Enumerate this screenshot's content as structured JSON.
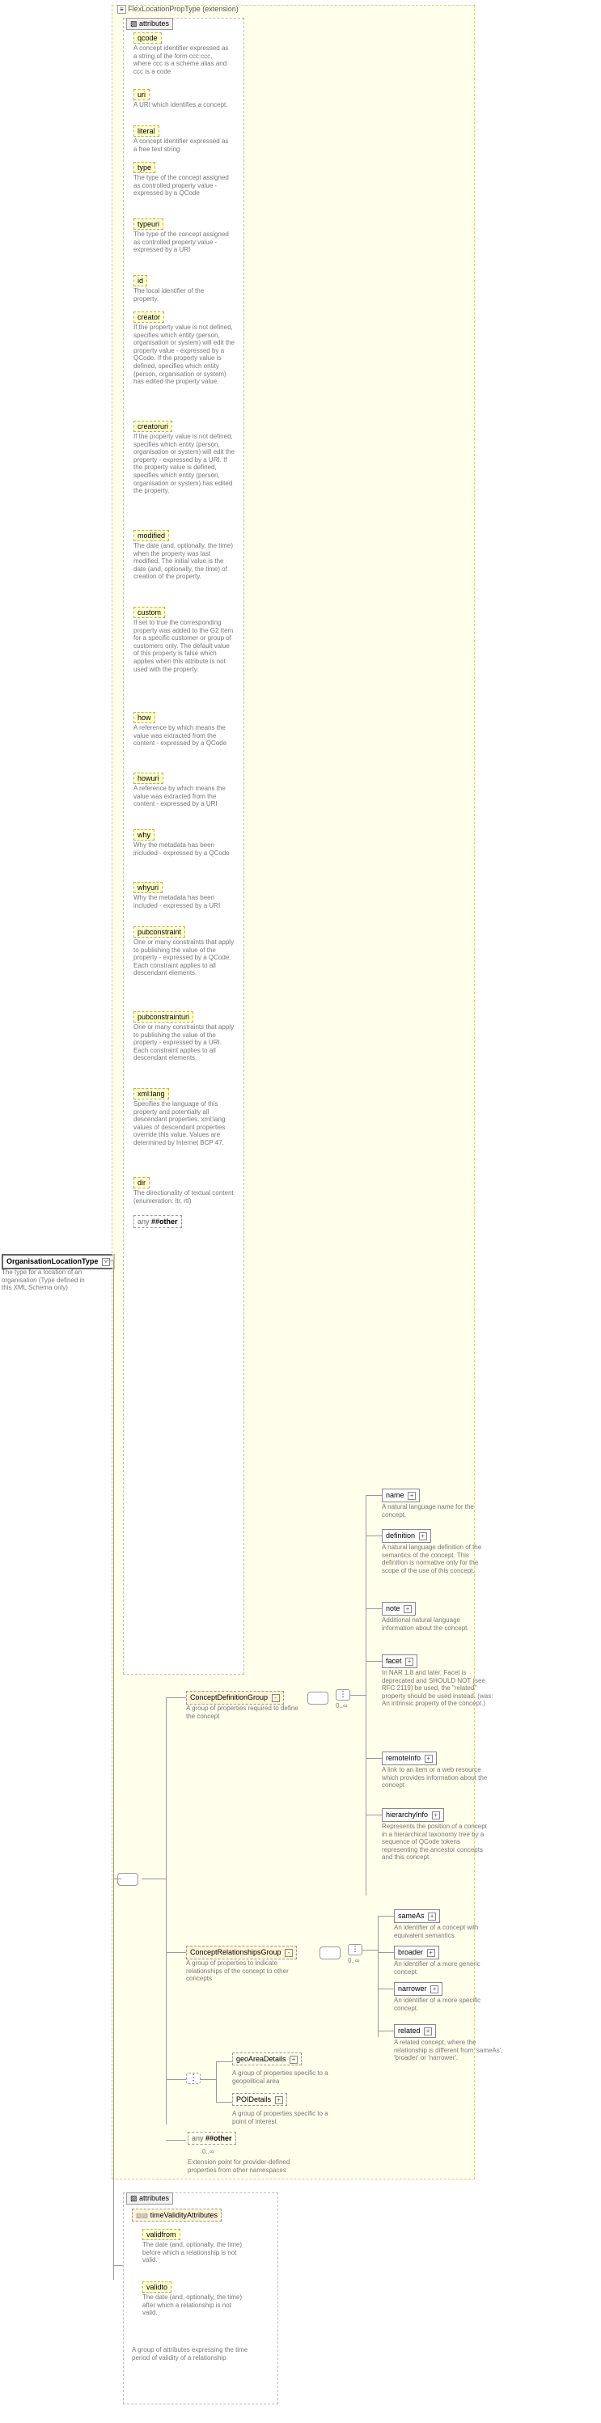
{
  "root": {
    "label": "OrganisationLocationType",
    "desc": "The type for a location of an organisation (Type defined in this XML Schema only)"
  },
  "extension": {
    "label": "FlexLocationPropType (extension)"
  },
  "attributes_hdr": "attributes",
  "attrs": [
    {
      "k": "qcode",
      "d": "A concept identifier expressed as a string of the form ccc:ccc, where ccc is a scheme alias and ccc is a code"
    },
    {
      "k": "uri",
      "d": "A URI which identifies a concept."
    },
    {
      "k": "literal",
      "d": "A concept identifier expressed as a free text string"
    },
    {
      "k": "type",
      "d": "The type of the concept assigned as controlled property value - expressed by a QCode"
    },
    {
      "k": "typeuri",
      "d": "The type of the concept assigned as controlled property value - expressed by a URI"
    },
    {
      "k": "id",
      "d": "The local identifier of the property."
    },
    {
      "k": "creator",
      "d": "If the property value is not defined, specifies which entity (person, organisation or system) will edit the property value - expressed by a QCode. If the property value is defined, specifies which entity (person, organisation or system) has edited the property value."
    },
    {
      "k": "creatoruri",
      "d": "If the property value is not defined, specifies which entity (person, organisation or system) will edit the property - expressed by a URI. If the property value is defined, specifies which entity (person, organisation or system) has edited the property."
    },
    {
      "k": "modified",
      "d": "The date (and, optionally, the time) when the property was last modified. The initial value is the date (and, optionally, the time) of creation of the property."
    },
    {
      "k": "custom",
      "d": "If set to true the corresponding property was added to the G2 Item for a specific customer or group of customers only. The default value of this property is false which applies when this attribute is not used with the property."
    },
    {
      "k": "how",
      "d": "A reference by which means the value was extracted from the content - expressed by a QCode"
    },
    {
      "k": "howuri",
      "d": "A reference by which means the value was extracted from the content - expressed by a URI"
    },
    {
      "k": "why",
      "d": "Why the metadata has been included - expressed by a QCode"
    },
    {
      "k": "whyuri",
      "d": "Why the metadata has been included - expressed by a URI"
    },
    {
      "k": "pubconstraint",
      "d": "One or many constraints that apply to publishing the value of the property - expressed by a QCode. Each constraint applies to all descendant elements."
    },
    {
      "k": "pubconstrainturi",
      "d": "One or many constraints that apply to publishing the value of the property - expressed by a URI. Each constraint applies to all descendant elements."
    },
    {
      "k": "xml:lang",
      "d": "Specifies the language of this property and potentially all descendant properties. xml:lang values of descendant properties override this value. Values are determined by Internet BCP 47."
    },
    {
      "k": "dir",
      "d": "The directionality of textual content (enumeration: ltr, rtl)"
    }
  ],
  "any_other": "##other",
  "any_label": "any",
  "cdg": {
    "label": "ConceptDefinitionGroup",
    "desc": "A group of properties required to define the concept",
    "occ": "0..∞"
  },
  "crg": {
    "label": "ConceptRelationshipsGroup",
    "desc": "A group of properties to indicate relationships of the concept to other concepts",
    "occ": "0..∞"
  },
  "cdg_items": [
    {
      "k": "name",
      "d": "A natural language name for the concept."
    },
    {
      "k": "definition",
      "d": "A natural language definition of the semantics of the concept. This definition is normative only for the scope of the use of this concept."
    },
    {
      "k": "note",
      "d": "Additional natural language information about the concept."
    },
    {
      "k": "facet",
      "d": "In NAR 1.8 and later. Facet is deprecated and SHOULD NOT (see RFC 2119) be used, the \"related\" property should be used instead. (was: An intrinsic property of the concept.)"
    },
    {
      "k": "remoteInfo",
      "d": "A link to an item or a web resource which provides information about the concept"
    },
    {
      "k": "hierarchyInfo",
      "d": "Represents the position of a concept in a hierarchical taxonomy tree by a sequence of QCode tokens representing the ancestor concepts and this concept"
    }
  ],
  "crg_items": [
    {
      "k": "sameAs",
      "d": "An identifier of a concept with equivalent semantics"
    },
    {
      "k": "broader",
      "d": "An identifier of a more generic concept."
    },
    {
      "k": "narrower",
      "d": "An identifier of a more specific concept."
    },
    {
      "k": "related",
      "d": "A related concept, where the relationship is different from 'sameAs', 'broader' or 'narrower'."
    }
  ],
  "geo": {
    "k": "geoAreaDetails",
    "d": "A group of properties specific to a geopolitical area"
  },
  "poi": {
    "k": "POIDetails",
    "d": "A group of properties specific to a point of interest"
  },
  "any_ext": {
    "label": "##other",
    "occ": "0..∞",
    "d": "Extension point for provider-defined properties from other namespaces"
  },
  "time": {
    "group": "timeValidityAttributes",
    "validfrom": {
      "k": "validfrom",
      "d": "The date (and, optionally, the time) before which a relationship is not valid."
    },
    "validto": {
      "k": "validto",
      "d": "The date (and, optionally, the time) after which a relationship is not valid."
    },
    "desc": "A group of attributes expressing the time period of validity of a relationship"
  }
}
